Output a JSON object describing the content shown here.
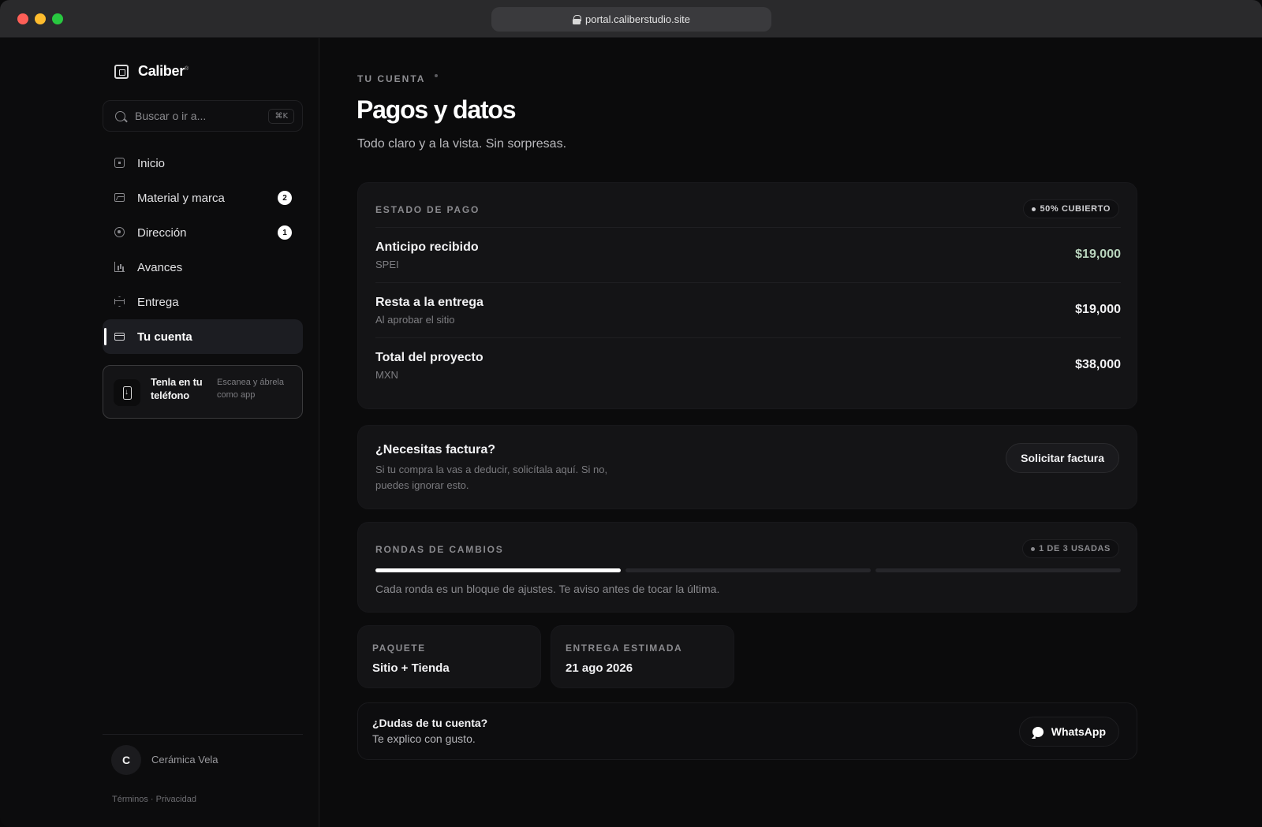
{
  "browser": {
    "url": "portal.caliberstudio.site"
  },
  "sidebar": {
    "brand": "Caliber",
    "brand_mark": "®",
    "search": {
      "placeholder": "Buscar o ir a...",
      "shortcut": "⌘K"
    },
    "items": [
      {
        "label": "Inicio",
        "icon": "home-square-icon",
        "badge": null,
        "active": false
      },
      {
        "label": "Material y marca",
        "icon": "image-icon",
        "badge": "2",
        "active": false
      },
      {
        "label": "Dirección",
        "icon": "target-icon",
        "badge": "1",
        "active": false
      },
      {
        "label": "Avances",
        "icon": "bar-chart-icon",
        "badge": null,
        "active": false
      },
      {
        "label": "Entrega",
        "icon": "package-icon",
        "badge": null,
        "active": false
      },
      {
        "label": "Tu cuenta",
        "icon": "credit-card-icon",
        "badge": null,
        "active": true
      }
    ],
    "install_card": {
      "title": "Tenla en tu teléfono",
      "subtitle": "Escanea y ábrela como app"
    },
    "user": {
      "initial": "C",
      "name": "Cerámica Vela"
    },
    "legal": "Términos · Privacidad"
  },
  "main": {
    "eyebrow": "TU CUENTA",
    "title": "Pagos y datos",
    "subtitle": "Todo claro y a la vista. Sin sorpresas.",
    "payment": {
      "label": "ESTADO DE PAGO",
      "status": "50% CUBIERTO",
      "rows": [
        {
          "label": "Anticipo recibido",
          "note": "SPEI",
          "amount": "$19,000"
        },
        {
          "label": "Resta a la entrega",
          "note": "Al aprobar el sitio",
          "amount": "$19,000"
        },
        {
          "label": "Total del proyecto",
          "note": "MXN",
          "amount": "$38,000"
        }
      ]
    },
    "invoice": {
      "title": "¿Necesitas factura?",
      "description": "Si tu compra la vas a deducir, solicítala aquí. Si no, puedes ignorar esto.",
      "button": "Solicitar factura"
    },
    "rounds": {
      "label": "RONDAS DE CAMBIOS",
      "status": "1 DE 3 USADAS",
      "used": 1,
      "total": 3,
      "note": "Cada ronda es un bloque de ajustes. Te aviso antes de tocar la última."
    },
    "package": {
      "label": "PAQUETE",
      "value": "Sitio + Tienda"
    },
    "delivery": {
      "label": "ENTREGA ESTIMADA",
      "value": "21 ago 2026"
    },
    "help": {
      "title": "¿Dudas de tu cuenta?",
      "subtitle": "Te explico con gusto.",
      "button": "WhatsApp"
    }
  },
  "colors": {
    "background": "#0b0b0c",
    "card": "#141416",
    "positive_amount": "#b9d4bd",
    "accent": "#ffffff"
  }
}
